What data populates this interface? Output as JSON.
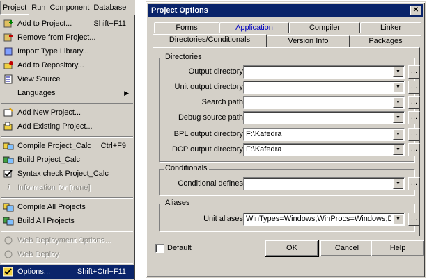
{
  "menubar": {
    "items": [
      "Project",
      "Run",
      "Component",
      "Database"
    ]
  },
  "project_menu": {
    "items": [
      {
        "label": "Add to Project...",
        "shortcut": "Shift+F11",
        "icon": "add-to-project-icon"
      },
      {
        "label": "Remove from Project...",
        "shortcut": "",
        "icon": "remove-from-project-icon"
      },
      {
        "label": "Import Type Library...",
        "shortcut": "",
        "icon": "import-type-library-icon"
      },
      {
        "label": "Add to Repository...",
        "shortcut": "",
        "icon": "add-to-repository-icon"
      },
      {
        "label": "View Source",
        "shortcut": "",
        "icon": "view-source-icon"
      },
      {
        "label": "Languages",
        "shortcut": "",
        "icon": ""
      },
      {
        "label": "Add New Project...",
        "shortcut": "",
        "icon": "add-new-project-icon"
      },
      {
        "label": "Add Existing Project...",
        "shortcut": "",
        "icon": "add-existing-project-icon"
      },
      {
        "label": "Compile Project_Calc",
        "shortcut": "Ctrl+F9",
        "icon": "compile-icon"
      },
      {
        "label": "Build Project_Calc",
        "shortcut": "",
        "icon": "build-icon"
      },
      {
        "label": "Syntax check Project_Calc",
        "shortcut": "",
        "icon": "syntax-check-icon"
      },
      {
        "label": "Information for [none]",
        "shortcut": "",
        "icon": "information-icon"
      },
      {
        "label": "Compile All Projects",
        "shortcut": "",
        "icon": "compile-all-icon"
      },
      {
        "label": "Build All Projects",
        "shortcut": "",
        "icon": "build-all-icon"
      },
      {
        "label": "Web Deployment Options...",
        "shortcut": "",
        "icon": "web-deployment-icon"
      },
      {
        "label": "Web Deploy",
        "shortcut": "",
        "icon": "web-deploy-icon"
      },
      {
        "label": "Options...",
        "shortcut": "Shift+Ctrl+F11",
        "icon": "options-icon"
      }
    ]
  },
  "dialog": {
    "title": "Project Options",
    "close_label": "✕",
    "tabs_back": [
      "Forms",
      "Application",
      "Compiler",
      "Linker"
    ],
    "tabs_front": [
      "Directories/Conditionals",
      "Version Info",
      "Packages"
    ],
    "groups": {
      "directories": "Directories",
      "conditionals": "Conditionals",
      "aliases": "Aliases"
    },
    "fields": [
      {
        "label": "Output directory:",
        "value": ""
      },
      {
        "label": "Unit output directory:",
        "value": ""
      },
      {
        "label": "Search path:",
        "value": ""
      },
      {
        "label": "Debug source path:",
        "value": ""
      },
      {
        "label": "BPL output directory:",
        "value": "F:\\Kafedra"
      },
      {
        "label": "DCP output directory:",
        "value": "F:\\Kafedra"
      }
    ],
    "conditional_defines": {
      "label": "Conditional defines:",
      "value": ""
    },
    "unit_aliases": {
      "label": "Unit aliases:",
      "value": "WinTypes=Windows;WinProcs=Windows;DbiT"
    },
    "ellipsis": "...",
    "default_label": "Default",
    "ok_label": "OK",
    "cancel_label": "Cancel",
    "help_label": "Help"
  }
}
